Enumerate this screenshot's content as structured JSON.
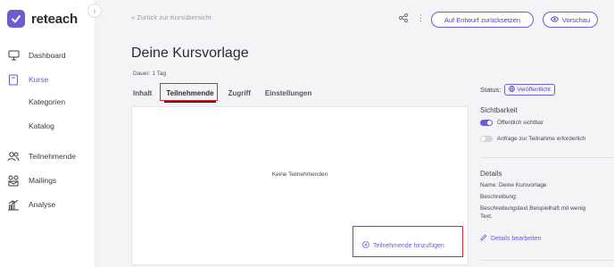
{
  "brand": {
    "name": "reteach",
    "accent": "#6d5bd0"
  },
  "sidebar": {
    "items": [
      {
        "label": "Dashboard",
        "icon": "monitor-icon"
      },
      {
        "label": "Kurse",
        "icon": "book-icon"
      },
      {
        "label": "Teilnehmende",
        "icon": "users-icon"
      },
      {
        "label": "Mailings",
        "icon": "mailing-icon"
      },
      {
        "label": "Analyse",
        "icon": "chart-icon"
      }
    ],
    "subitems": [
      {
        "label": "Kategorien"
      },
      {
        "label": "Katalog"
      }
    ]
  },
  "header": {
    "back_label": "Zurück zur Kursübersicht",
    "reset_button": "Auf Entwurf zurücksetzen",
    "preview_button": "Vorschau"
  },
  "course": {
    "title": "Deine Kursvorlage",
    "duration": "Dauer: 1 Tag"
  },
  "tabs": [
    {
      "label": "Inhalt"
    },
    {
      "label": "Teilnehmende"
    },
    {
      "label": "Zugriff"
    },
    {
      "label": "Einstellungen"
    }
  ],
  "participants": {
    "empty_text": "Keine Teilnehmenden",
    "add_label": "Teilnehmende hinzufügen"
  },
  "side": {
    "status_label": "Status:",
    "status_value": "Veröffentlicht",
    "visibility_title": "Sichtbarkeit",
    "public_label": "Öffentlich sichtbar",
    "public_on": true,
    "request_label": "Anfrage zur Teilnahme erforderlich",
    "request_on": false,
    "details_title": "Details",
    "name_line": "Name: Deine Kursvorlage",
    "desc_label": "Beschreibung:",
    "desc_text": "Beschreibungstext Beispielhaft mit wenig Text.",
    "edit_label": "Details bearbeiten"
  }
}
